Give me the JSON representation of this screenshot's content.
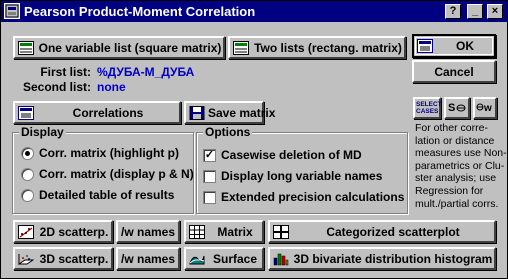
{
  "window": {
    "title": "Pearson Product-Moment Correlation",
    "caption_buttons": {
      "help": "?",
      "minimize": "_",
      "close": "×"
    }
  },
  "buttons": {
    "one_variable_list": "One variable list (square matrix)",
    "two_lists": "Two lists (rectang. matrix)",
    "ok": "OK",
    "cancel": "Cancel",
    "correlations": "Correlations",
    "save_matrix": "Save matrix",
    "select_cases": "SELECT CASES",
    "scatter_2d": "2D scatterp.",
    "scatter_2d_names": "/w names",
    "scatter_3d": "3D scatterp.",
    "scatter_3d_names": "/w names",
    "matrix": "Matrix",
    "surface": "Surface",
    "categorized_scatterplot": "Categorized scatterplot",
    "bivariate_histogram": "3D bivariate distribution histogram"
  },
  "lists": {
    "first_label": "First list:",
    "first_value": "%ДУБА-М_ДУБА",
    "second_label": "Second list:",
    "second_value": "none"
  },
  "display": {
    "title": "Display",
    "options": [
      {
        "label": "Corr. matrix (highlight p)",
        "selected": true
      },
      {
        "label": "Corr. matrix (display p & N)",
        "selected": false
      },
      {
        "label": "Detailed table of results",
        "selected": false
      }
    ]
  },
  "options": {
    "title": "Options",
    "items": [
      {
        "label": "Casewise deletion of MD",
        "checked": true
      },
      {
        "label": "Display long variable names",
        "checked": false
      },
      {
        "label": "Extended precision calculations",
        "checked": false
      }
    ]
  },
  "info_lines": [
    "For other corre-",
    "lation or distance",
    "measures use Non-",
    "parametrics or Clu-",
    "ster analysis; use",
    "Regression for",
    "mult./partial corrs."
  ],
  "colors": {
    "title_bar": "#000080",
    "list_values": "#0000c8",
    "face": "#c0c0c0"
  }
}
